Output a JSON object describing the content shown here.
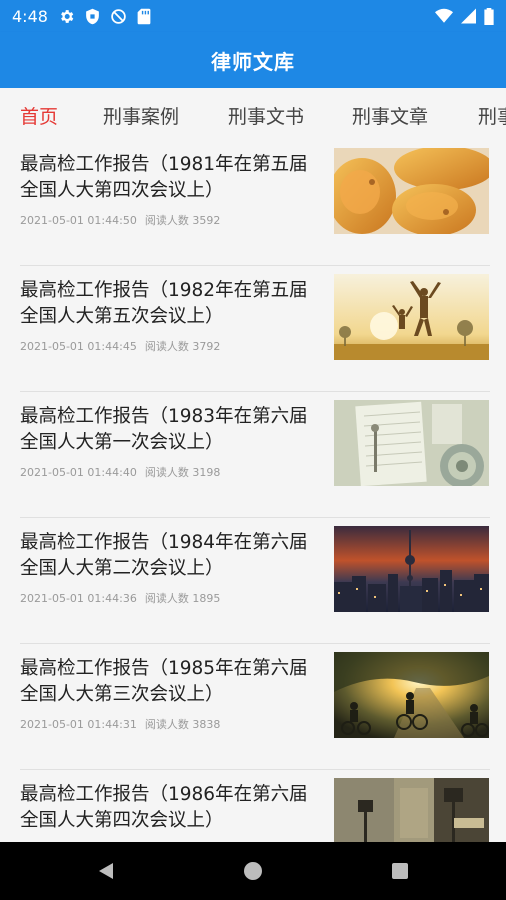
{
  "status_bar": {
    "time": "4:48",
    "left_icons": [
      "gear-icon",
      "shield-icon",
      "no-sync-icon",
      "sd-card-icon"
    ],
    "right_icons": [
      "wifi-icon",
      "cell-signal-icon",
      "battery-icon"
    ]
  },
  "app_bar": {
    "title": "律师文库"
  },
  "tabs": [
    {
      "label": "首页",
      "active": true
    },
    {
      "label": "刑事案例",
      "active": false
    },
    {
      "label": "刑事文书",
      "active": false
    },
    {
      "label": "刑事文章",
      "active": false
    },
    {
      "label": "刑事",
      "active": false
    }
  ],
  "articles": [
    {
      "title": "最高检工作报告（1981年在第五届全国人大第四次会议上）",
      "date": "2021-05-01 01:44:50",
      "readers": "阅读人数 3592",
      "image": "pastry-photo"
    },
    {
      "title": "最高检工作报告（1982年在第五届全国人大第五次会议上）",
      "date": "2021-05-01 01:44:45",
      "readers": "阅读人数 3792",
      "image": "jumping-people-sunset-photo"
    },
    {
      "title": "最高检工作报告（1983年在第六届全国人大第一次会议上）",
      "date": "2021-05-01 01:44:40",
      "readers": "阅读人数 3198",
      "image": "desk-notebook-photo"
    },
    {
      "title": "最高检工作报告（1984年在第六届全国人大第二次会议上）",
      "date": "2021-05-01 01:44:36",
      "readers": "阅读人数 1895",
      "image": "city-skyline-night-photo"
    },
    {
      "title": "最高检工作报告（1985年在第六届全国人大第三次会议上）",
      "date": "2021-05-01 01:44:31",
      "readers": "阅读人数 3838",
      "image": "cyclists-sunset-photo"
    },
    {
      "title": "最高检工作报告（1986年在第六届全国人大第四次会议上）",
      "date": "",
      "readers": "",
      "image": "street-lamps-photo"
    }
  ],
  "nav_bar": {
    "buttons": [
      "back-icon",
      "home-icon",
      "recent-apps-icon"
    ]
  }
}
